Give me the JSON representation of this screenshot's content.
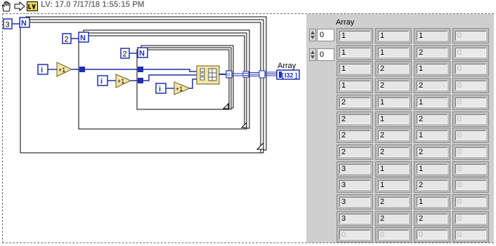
{
  "toolbar": {
    "version_text": "LV: 17.0 7/17/18 1:55:15 PM",
    "hand_icon": "operate-hand-icon",
    "arrow_icon": "run-arrow-icon",
    "logo_icon": "labview-logo-icon"
  },
  "diagram": {
    "outer_loop_count": "3",
    "middle_loop_count": "2",
    "inner_loop_count": "2",
    "count_terminal": "N",
    "iteration_terminal": "i",
    "increment_label": "+1",
    "tunnel_index": "0",
    "indicator_label": "Array",
    "indicator_type": "I32"
  },
  "front_panel": {
    "array_label": "Array",
    "index_values": [
      "0",
      "0"
    ],
    "rows": [
      [
        "1",
        "1",
        "1",
        "0"
      ],
      [
        "1",
        "1",
        "2",
        "0"
      ],
      [
        "1",
        "2",
        "1",
        "0"
      ],
      [
        "1",
        "2",
        "2",
        "0"
      ],
      [
        "2",
        "1",
        "1",
        "0"
      ],
      [
        "2",
        "1",
        "2",
        "0"
      ],
      [
        "2",
        "2",
        "1",
        "0"
      ],
      [
        "2",
        "2",
        "2",
        "0"
      ],
      [
        "3",
        "1",
        "1",
        "0"
      ],
      [
        "3",
        "1",
        "2",
        "0"
      ],
      [
        "3",
        "2",
        "1",
        "0"
      ],
      [
        "3",
        "2",
        "2",
        "0"
      ],
      [
        "0",
        "0",
        "0",
        "0"
      ]
    ]
  },
  "colors": {
    "wire_blue": "#1d2fb0",
    "increment_fill": "#f2e7a8",
    "panel_gray": "#cfcfcf"
  }
}
